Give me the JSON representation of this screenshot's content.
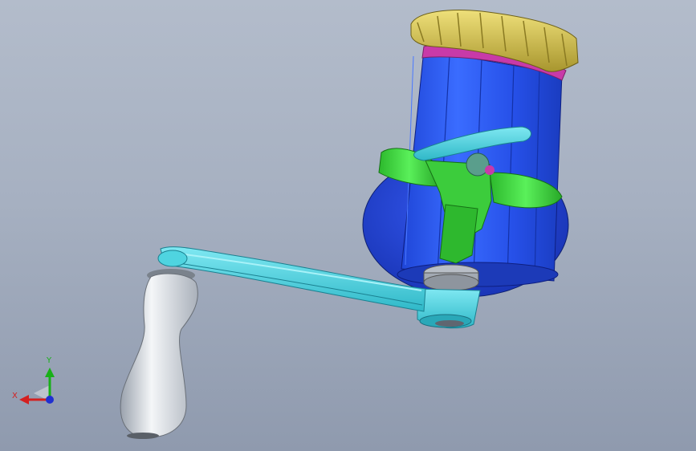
{
  "triad": {
    "x_label": "X",
    "y_label": "Y",
    "colors": {
      "x": "#d42020",
      "y": "#18b018",
      "z": "#2030d0"
    }
  },
  "model_colors": {
    "bowl": "#2a4fd6",
    "drum": "#2f5ff0",
    "crown": "#cfc048",
    "ring": "#c83aa8",
    "crank_arm": "#4fd4e0",
    "handle": "#d8dde4",
    "bale": "#3fd63f"
  }
}
